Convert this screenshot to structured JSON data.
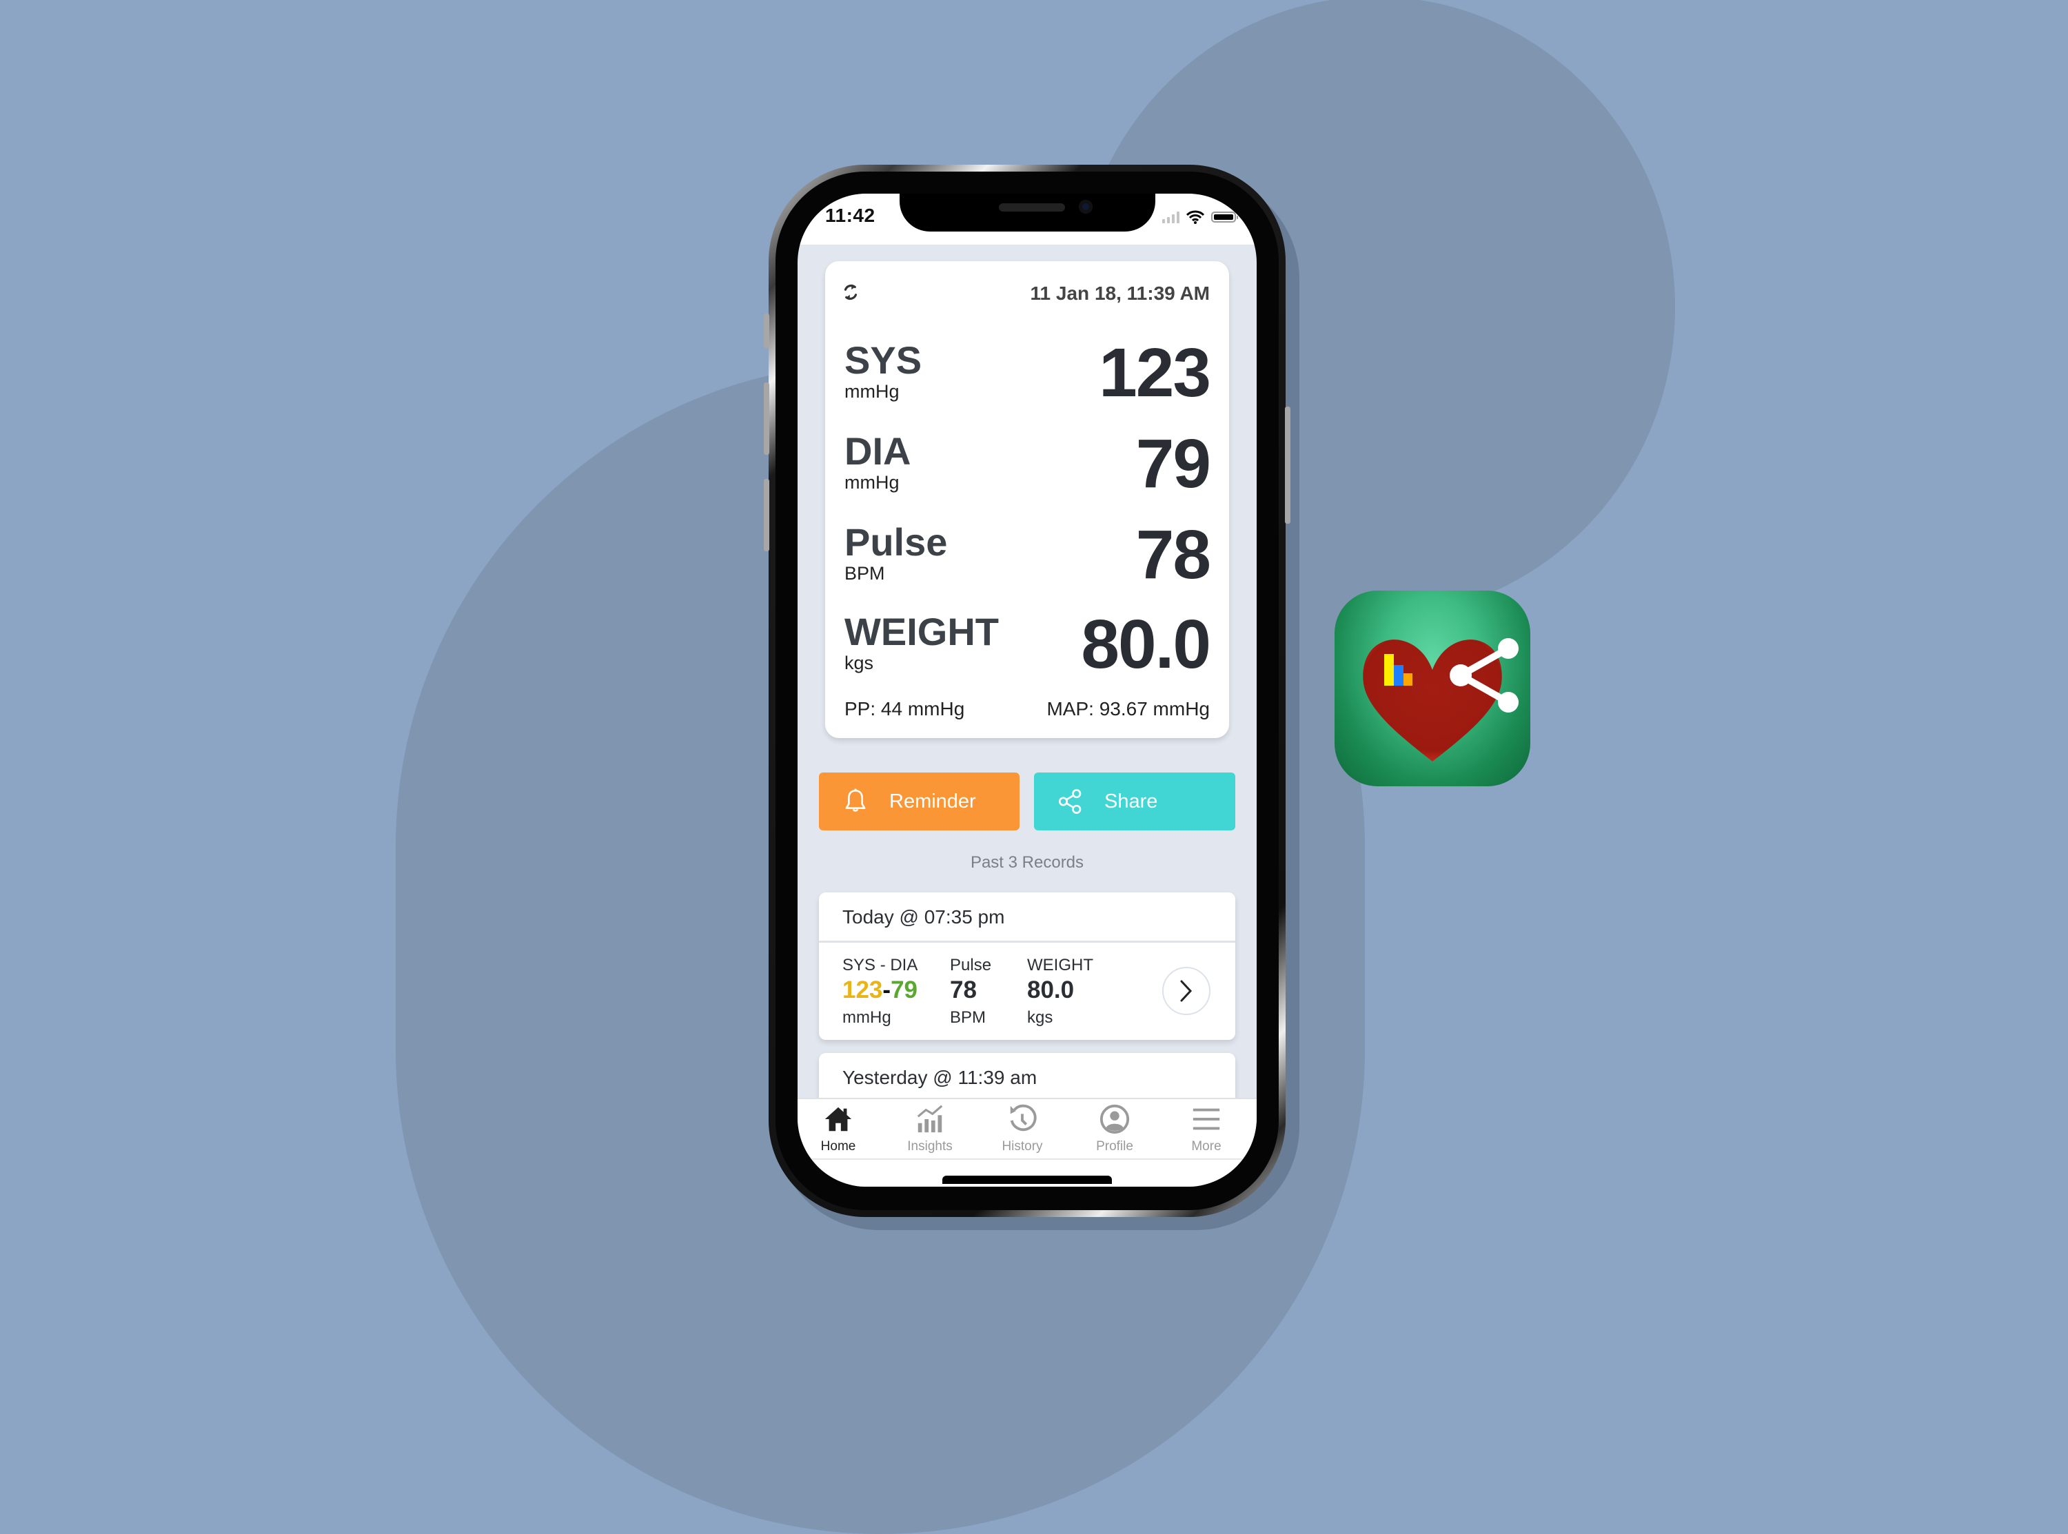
{
  "status_bar": {
    "time": "11:42",
    "signal_icon": "cellular-signal-icon",
    "wifi_icon": "wifi-icon",
    "battery_icon": "battery-icon"
  },
  "reading": {
    "refresh_icon": "sync-icon",
    "datetime": "11 Jan 18, 11:39 AM",
    "metrics": [
      {
        "label": "SYS",
        "unit": "mmHg",
        "value": "123"
      },
      {
        "label": "DIA",
        "unit": "mmHg",
        "value": "79"
      },
      {
        "label": "Pulse",
        "unit": "BPM",
        "value": "78"
      },
      {
        "label": "WEIGHT",
        "unit": "kgs",
        "value": "80.0"
      }
    ],
    "pp": "PP: 44 mmHg",
    "map": "MAP: 93.67 mmHg"
  },
  "actions": {
    "reminder": {
      "label": "Reminder",
      "icon": "bell-icon",
      "color": "#fb9637"
    },
    "share": {
      "label": "Share",
      "icon": "share-icon",
      "color": "#41d6d3"
    }
  },
  "records": {
    "title": "Past 3 Records",
    "items": [
      {
        "heading": "Today @ 07:35 pm",
        "bp_label": "SYS - DIA",
        "sys": "123",
        "dash": "-",
        "dia": "79",
        "bp_unit": "mmHg",
        "pulse_label": "Pulse",
        "pulse": "78",
        "pulse_unit": "BPM",
        "weight_label": "WEIGHT",
        "weight": "80.0",
        "weight_unit": "kgs",
        "sys_color": "#e9b417",
        "dia_color": "#5aa832"
      },
      {
        "heading": "Yesterday @ 11:39 am"
      }
    ]
  },
  "tabs": [
    {
      "label": "Home",
      "icon": "home-icon",
      "active": true
    },
    {
      "label": "Insights",
      "icon": "insights-chart-icon",
      "active": false
    },
    {
      "label": "History",
      "icon": "history-icon",
      "active": false
    },
    {
      "label": "Profile",
      "icon": "profile-icon",
      "active": false
    },
    {
      "label": "More",
      "icon": "menu-icon",
      "active": false
    }
  ],
  "app_icon": {
    "name": "heart-share-app-icon",
    "bg_color": "#2fa56c",
    "heart_color": "#a01b12"
  }
}
